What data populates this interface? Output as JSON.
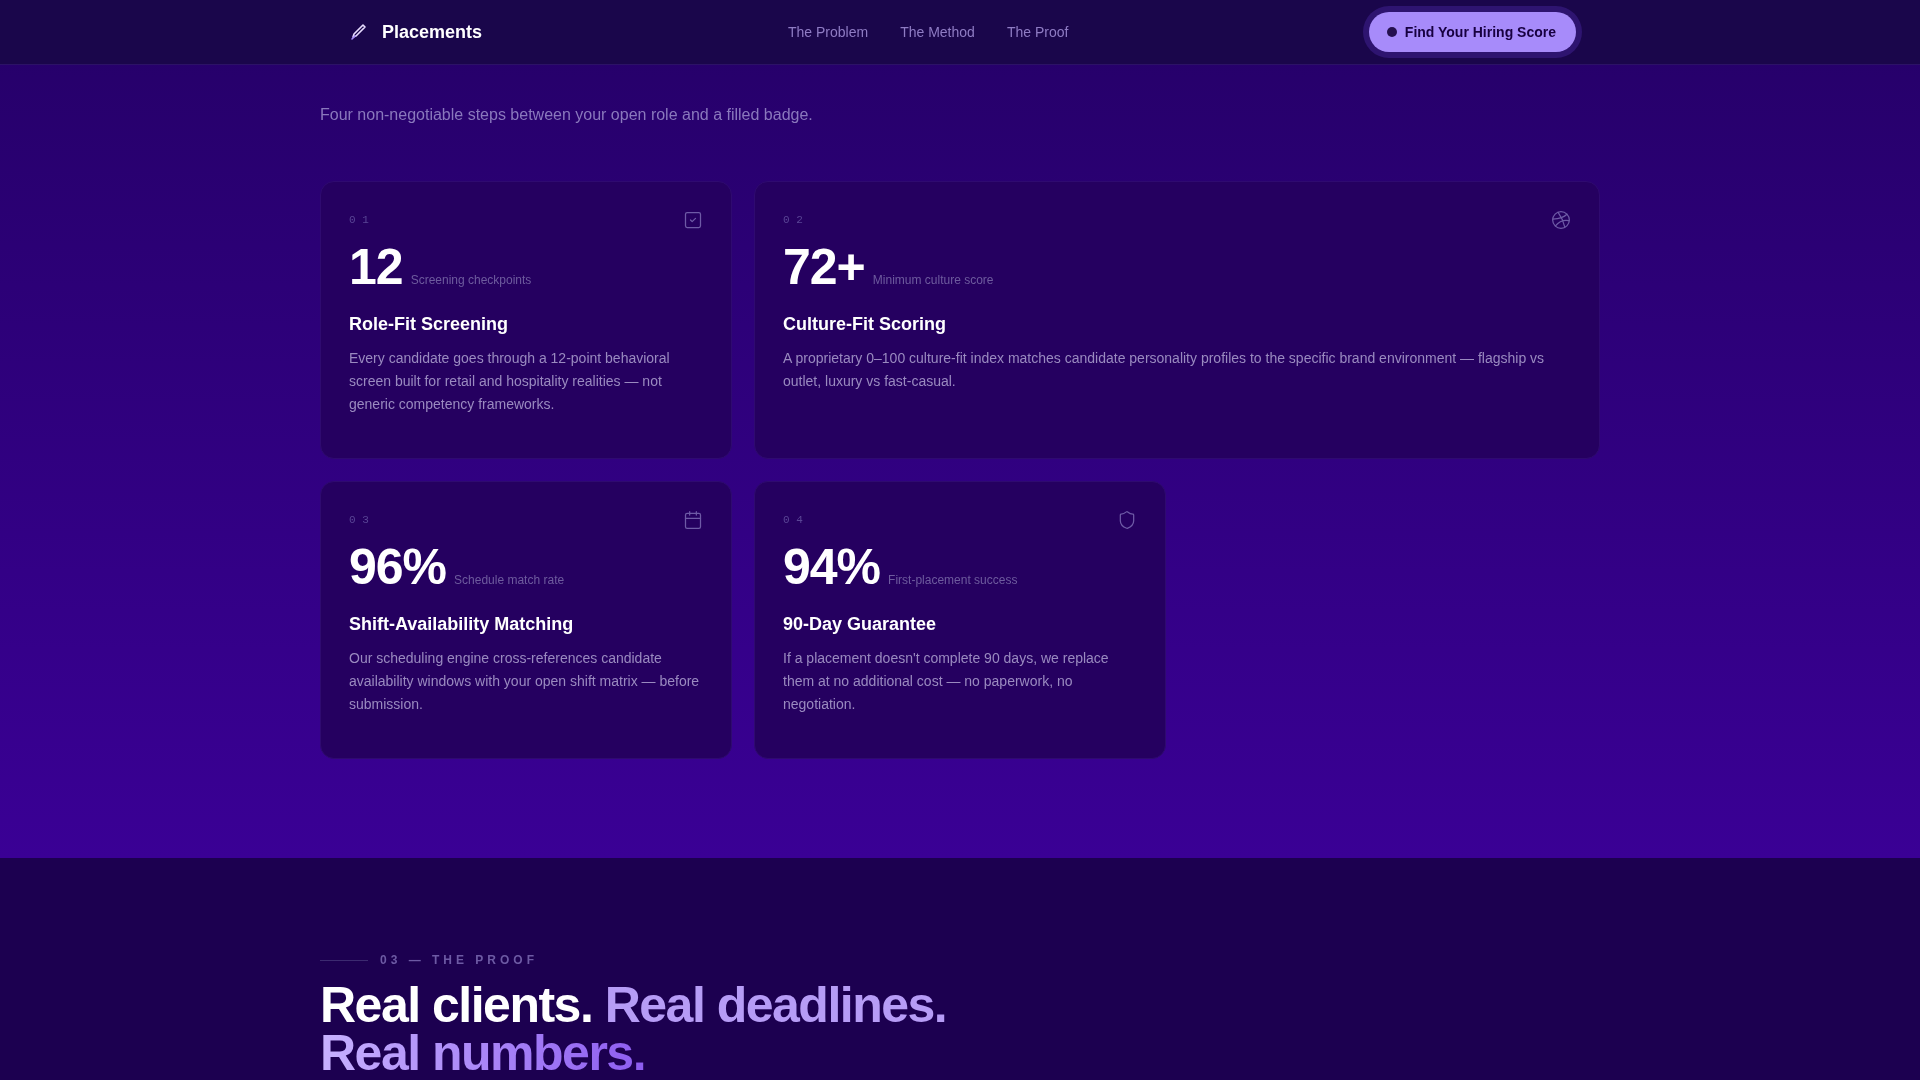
{
  "header": {
    "brand": "Placements",
    "nav": [
      {
        "label": "The Problem"
      },
      {
        "label": "The Method"
      },
      {
        "label": "The Proof"
      }
    ],
    "cta": "Find Your Hiring Score"
  },
  "method": {
    "subtitle": "Four non-negotiable steps between your open role and a filled badge.",
    "cards": [
      {
        "index": "0 1",
        "value": "12",
        "caption": "Screening checkpoints",
        "title": "Role-Fit Screening",
        "body": "Every candidate goes through a 12-point behavioral screen built for retail and hospitality realities — not generic competency frameworks.",
        "wide": false
      },
      {
        "index": "0 2",
        "value": "72+",
        "caption": "Minimum culture score",
        "title": "Culture-Fit Scoring",
        "body": "A proprietary 0–100 culture-fit index matches candidate personality profiles to the specific brand environment — flagship vs outlet, luxury vs fast-casual.",
        "wide": true
      },
      {
        "index": "0 3",
        "value": "96%",
        "caption": "Schedule match rate",
        "title": "Shift-Availability Matching",
        "body": "Our scheduling engine cross-references candidate availability windows with your open shift matrix — before submission.",
        "wide": false
      },
      {
        "index": "0 4",
        "value": "94%",
        "caption": "First-placement success",
        "title": "90-Day Guarantee",
        "body": "If a placement doesn't complete 90 days, we replace them at no additional cost — no paperwork, no negotiation.",
        "wide": false
      }
    ]
  },
  "proof": {
    "eyebrow": "03 — THE PROOF",
    "headline": [
      {
        "text": "Real clients.",
        "kind": "plain"
      },
      {
        "text": "Real deadlines.",
        "kind": "accent"
      },
      {
        "text": "Real numbers.",
        "kind": "gradient"
      }
    ]
  }
}
